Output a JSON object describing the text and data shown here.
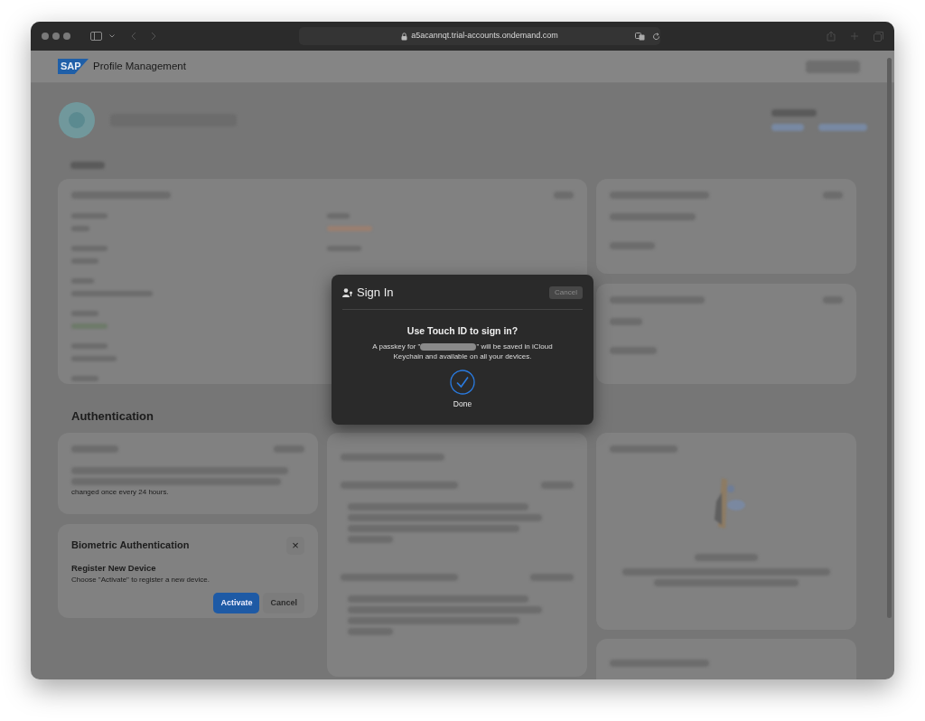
{
  "browser": {
    "url": "a5acannqt.trial-accounts.ondemand.com"
  },
  "header": {
    "logo": "SAP",
    "title": "Profile Management"
  },
  "authentication": {
    "heading": "Authentication",
    "password_card": {
      "text": "changed once every 24 hours."
    },
    "biometric_card": {
      "title": "Biometric Authentication",
      "close": "×",
      "subtitle": "Register New Device",
      "description": "Choose \"Activate\" to register a new device.",
      "buttons": [
        {
          "label": "Activate",
          "kind": "primary"
        },
        {
          "label": "Cancel",
          "kind": "secondary"
        }
      ]
    }
  },
  "dialog": {
    "title": "Sign In",
    "cancel": "Cancel",
    "question": "Use Touch ID to sign in?",
    "message_before": "A passkey for \"",
    "message_after": "\" will be saved in iCloud Keychain and available on all your devices.",
    "status": "Done"
  }
}
